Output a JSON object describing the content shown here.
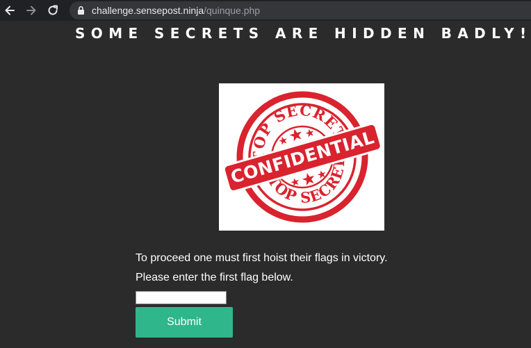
{
  "browser": {
    "icons": [
      "back-arrow-icon",
      "forward-arrow-icon",
      "reload-icon",
      "lock-icon"
    ],
    "url_host": "challenge.sensepost.ninja",
    "url_path": "/quinque.php"
  },
  "page": {
    "heading": "SOME SECRETS ARE HIDDEN BADLY!",
    "image": {
      "description": "red rubber stamp",
      "top_text": "TOP SECRET",
      "banner_text": "CONFIDENTIAL",
      "bottom_text": "TOP SECRET",
      "color": "#d9232e"
    },
    "prompt_line_1": "To proceed one must first hoist their flags in victory.",
    "prompt_line_2": "Please enter the first flag below.",
    "flag_input": {
      "value": "",
      "placeholder": ""
    },
    "submit_label": "Submit"
  },
  "colors": {
    "page_background": "#2b2b2b",
    "toolbar_background": "#202124",
    "submit_button": "#2fb68b"
  }
}
